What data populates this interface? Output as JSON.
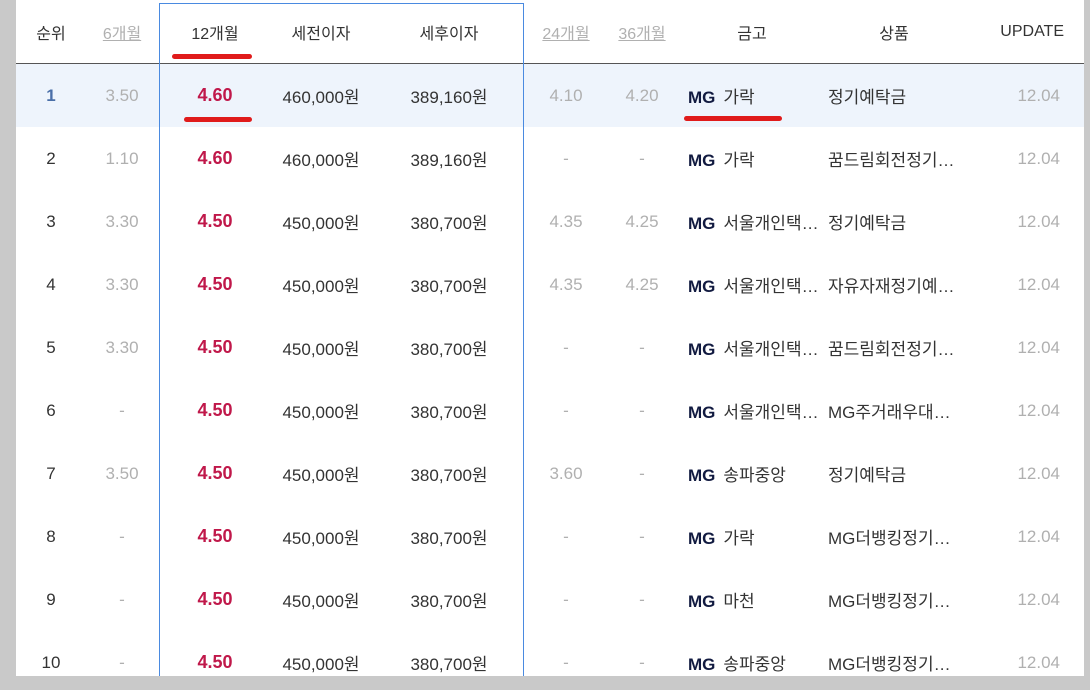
{
  "headers": {
    "rank": "순위",
    "m6": "6개월",
    "m12": "12개월",
    "pretax": "세전이자",
    "posttax": "세후이자",
    "m24": "24개월",
    "m36": "36개월",
    "bank": "금고",
    "product": "상품",
    "update": "UPDATE"
  },
  "highlight_color": "#4a8ae0",
  "rate_color": "#c0184a",
  "underline_color": "#e01b1b",
  "rows": [
    {
      "rank": "1",
      "m6": "3.50",
      "m12": "4.60",
      "pretax": "460,000원",
      "posttax": "389,160원",
      "m24": "4.10",
      "m36": "4.20",
      "mg": "MG",
      "bank": "가락",
      "product": "정기예탁금",
      "update": "12.04"
    },
    {
      "rank": "2",
      "m6": "1.10",
      "m12": "4.60",
      "pretax": "460,000원",
      "posttax": "389,160원",
      "m24": "-",
      "m36": "-",
      "mg": "MG",
      "bank": "가락",
      "product": "꿈드림회전정기…",
      "update": "12.04"
    },
    {
      "rank": "3",
      "m6": "3.30",
      "m12": "4.50",
      "pretax": "450,000원",
      "posttax": "380,700원",
      "m24": "4.35",
      "m36": "4.25",
      "mg": "MG",
      "bank": "서울개인택…",
      "product": "정기예탁금",
      "update": "12.04"
    },
    {
      "rank": "4",
      "m6": "3.30",
      "m12": "4.50",
      "pretax": "450,000원",
      "posttax": "380,700원",
      "m24": "4.35",
      "m36": "4.25",
      "mg": "MG",
      "bank": "서울개인택…",
      "product": "자유자재정기예…",
      "update": "12.04"
    },
    {
      "rank": "5",
      "m6": "3.30",
      "m12": "4.50",
      "pretax": "450,000원",
      "posttax": "380,700원",
      "m24": "-",
      "m36": "-",
      "mg": "MG",
      "bank": "서울개인택…",
      "product": "꿈드림회전정기…",
      "update": "12.04"
    },
    {
      "rank": "6",
      "m6": "-",
      "m12": "4.50",
      "pretax": "450,000원",
      "posttax": "380,700원",
      "m24": "-",
      "m36": "-",
      "mg": "MG",
      "bank": "서울개인택…",
      "product": "MG주거래우대정…",
      "update": "12.04"
    },
    {
      "rank": "7",
      "m6": "3.50",
      "m12": "4.50",
      "pretax": "450,000원",
      "posttax": "380,700원",
      "m24": "3.60",
      "m36": "-",
      "mg": "MG",
      "bank": "송파중앙",
      "product": "정기예탁금",
      "update": "12.04"
    },
    {
      "rank": "8",
      "m6": "-",
      "m12": "4.50",
      "pretax": "450,000원",
      "posttax": "380,700원",
      "m24": "-",
      "m36": "-",
      "mg": "MG",
      "bank": "가락",
      "product": "MG더뱅킹정기예금",
      "update": "12.04"
    },
    {
      "rank": "9",
      "m6": "-",
      "m12": "4.50",
      "pretax": "450,000원",
      "posttax": "380,700원",
      "m24": "-",
      "m36": "-",
      "mg": "MG",
      "bank": "마천",
      "product": "MG더뱅킹정기예금",
      "update": "12.04"
    },
    {
      "rank": "10",
      "m6": "-",
      "m12": "4.50",
      "pretax": "450,000원",
      "posttax": "380,700원",
      "m24": "-",
      "m36": "-",
      "mg": "MG",
      "bank": "송파중앙",
      "product": "MG더뱅킹정기예금",
      "update": "12.04"
    }
  ]
}
